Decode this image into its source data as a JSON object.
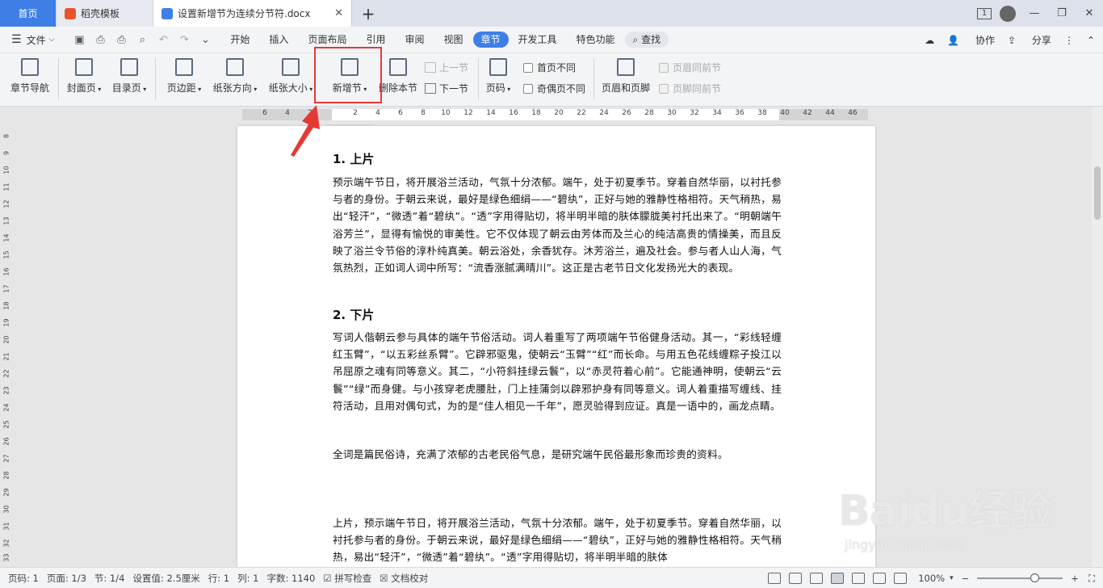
{
  "tabs": {
    "home": "首页",
    "template": "稻壳模板",
    "doc": "设置新增节为连续分节符.docx",
    "add": "+",
    "close": "✕"
  },
  "window": {
    "page_count_badge": "1"
  },
  "menubar": {
    "file": "文件",
    "items": [
      "开始",
      "插入",
      "页面布局",
      "引用",
      "审阅",
      "视图",
      "章节",
      "开发工具",
      "特色功能"
    ],
    "search": "查找",
    "collab": "协作",
    "share": "分享"
  },
  "ribbon": {
    "nav": "章节导航",
    "cover": "封面页",
    "toc": "目录页",
    "margin": "页边距",
    "orientation": "纸张方向",
    "size": "纸张大小",
    "new_section": "新增节",
    "delete_section": "删除本节",
    "prev_section": "上一节",
    "next_section": "下一节",
    "page_number": "页码",
    "first_page_diff": "首页不同",
    "odd_even_diff": "奇偶页不同",
    "header_footer": "页眉和页脚",
    "header_same": "页眉同前节",
    "footer_same": "页脚同前节"
  },
  "ruler": {
    "h_ticks": [
      "6",
      "4",
      "2",
      "2",
      "4",
      "6",
      "8",
      "10",
      "12",
      "14",
      "16",
      "18",
      "20",
      "22",
      "24",
      "26",
      "28",
      "30",
      "32",
      "34",
      "36",
      "38",
      "40",
      "42",
      "44",
      "46"
    ],
    "v_ticks": [
      "8",
      "9",
      "10",
      "11",
      "12",
      "13",
      "14",
      "15",
      "16",
      "17",
      "18",
      "19",
      "20",
      "21",
      "22",
      "23",
      "24",
      "25",
      "26",
      "27",
      "28",
      "29",
      "30",
      "31",
      "32",
      "33"
    ]
  },
  "document": {
    "h1": "1.  上片",
    "p1": "预示端午节日，将开展浴兰活动，气氛十分浓郁。端午，处于初夏季节。穿着自然华丽，以衬托参与者的身份。于朝云来说，最好是绿色细绢——“碧纨”，正好与她的雅静性格相符。天气稍热，易出“轻汗”，“微透”着“碧纨”。“透”字用得贴切，将半明半暗的肤体朦胧美衬托出来了。“明朝端午浴芳兰”，显得有愉悦的审美性。它不仅体现了朝云由芳体而及兰心的纯洁高贵的情操美，而且反映了浴兰令节俗的淳朴纯真美。朝云浴处，余香犹存。沐芳浴兰，遍及社会。参与者人山人海，气氛热烈，正如词人词中所写：“流香涨腻满晴川”。这正是古老节日文化发扬光大的表现。",
    "h2": "2.  下片",
    "p2": "写词人偕朝云参与具体的端午节俗活动。词人着重写了两项端午节俗健身活动。其一，“彩线轻缠红玉臂”，“以五彩丝系臂”。它辟邪驱鬼，使朝云“玉臂”“红”而长命。与用五色花线缠粽子投江以吊屈原之魂有同等意义。其二，“小符斜挂绿云鬟”，以“赤灵符着心前”。它能通神明，使朝云“云鬟”“绿”而身健。与小孩穿老虎腰肚，门上挂蒲剑以辟邪护身有同等意义。词人着重描写缠线、挂符活动，且用对偶句式，为的是“佳人相见一千年”，愿灵验得到应证。真是一语中的，画龙点睛。",
    "p3": "全词是篇民俗诗，充满了浓郁的古老民俗气息，是研究端午民俗最形象而珍贵的资料。",
    "p4": "上片，预示端午节日，将开展浴兰活动，气氛十分浓郁。端午，处于初夏季节。穿着自然华丽，以衬托参与者的身份。于朝云来说，最好是绿色细绢——“碧纨”，正好与她的雅静性格相符。天气稍热，易出“轻汗”，“微透”着“碧纨”。“透”字用得贴切，将半明半暗的肤体"
  },
  "status": {
    "page": "页码: 1",
    "pages": "页面: 1/3",
    "section": "节: 1/4",
    "setting": "设置值: 2.5厘米",
    "row": "行: 1",
    "col": "列: 1",
    "words": "字数: 1140",
    "spell": "拼写检查",
    "proof": "文档校对",
    "zoom": "100%",
    "zoom_minus": "−",
    "zoom_plus": "+"
  },
  "watermark": {
    "brand": "Baidu经验",
    "site": "jingyan.baidu.com"
  },
  "colors": {
    "accent": "#3e7fe6",
    "highlight": "#e53935"
  }
}
